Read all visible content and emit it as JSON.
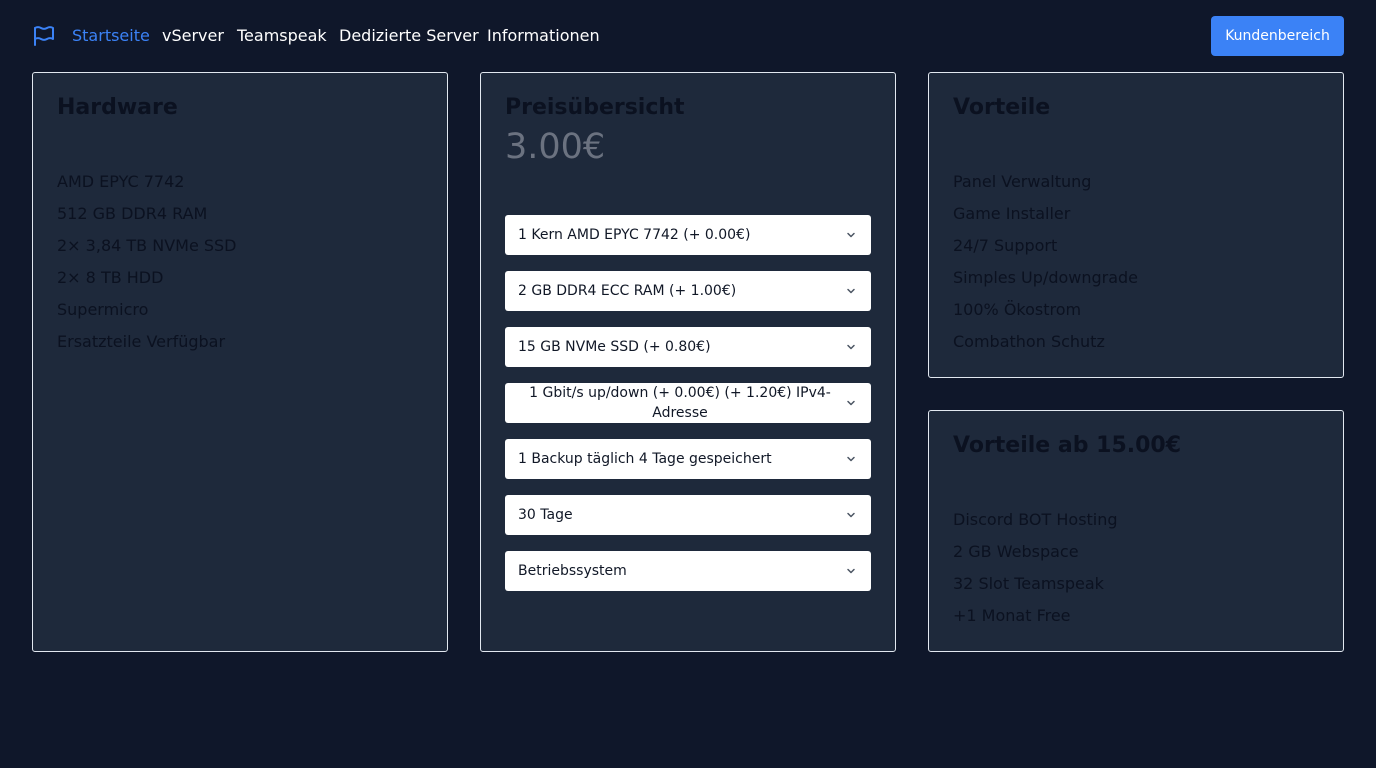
{
  "nav": {
    "logo_icon": "flag-icon",
    "links": [
      "Startseite",
      "vServer",
      "Teamspeak",
      "Dedizierte Server",
      "Informationen"
    ],
    "active_index": 0,
    "cta_label": "Kundenbereich"
  },
  "colors": {
    "background": "#0f172a",
    "card": "#1e293b",
    "accent": "#3b82f6",
    "card_border": "#e2e8f0"
  },
  "hardware": {
    "title": "Hardware",
    "items": [
      "AMD EPYC 7742",
      "512 GB DDR4 RAM",
      "2× 3,84 TB NVMe SSD",
      "2× 8 TB HDD",
      "Supermicro",
      "Ersatzteile Verfügbar"
    ]
  },
  "pricing": {
    "title": "Preisübersicht",
    "price": "3.00€",
    "selects": [
      "1 Kern AMD EPYC 7742 (+ 0.00€)",
      "2 GB DDR4 ECC RAM (+ 1.00€)",
      "15 GB NVMe SSD (+ 0.80€)",
      "1 Gbit/s up/down (+ 0.00€) (+ 1.20€) IPv4-Adresse",
      "1 Backup täglich 4 Tage gespeichert",
      "30 Tage",
      "Betriebssystem"
    ],
    "select_icon": "chevron-down-icon"
  },
  "vorteile": {
    "title": "Vorteile",
    "items": [
      "Panel Verwaltung",
      "Game Installer",
      "24/7 Support",
      "Simples Up/downgrade",
      "100% Ökostrom",
      "Combathon Schutz"
    ]
  },
  "vorteile_premium": {
    "title": "Vorteile ab 15.00€",
    "items": [
      "Discord BOT Hosting",
      "2 GB Webspace",
      "32 Slot Teamspeak",
      "+1 Monat Free"
    ]
  }
}
